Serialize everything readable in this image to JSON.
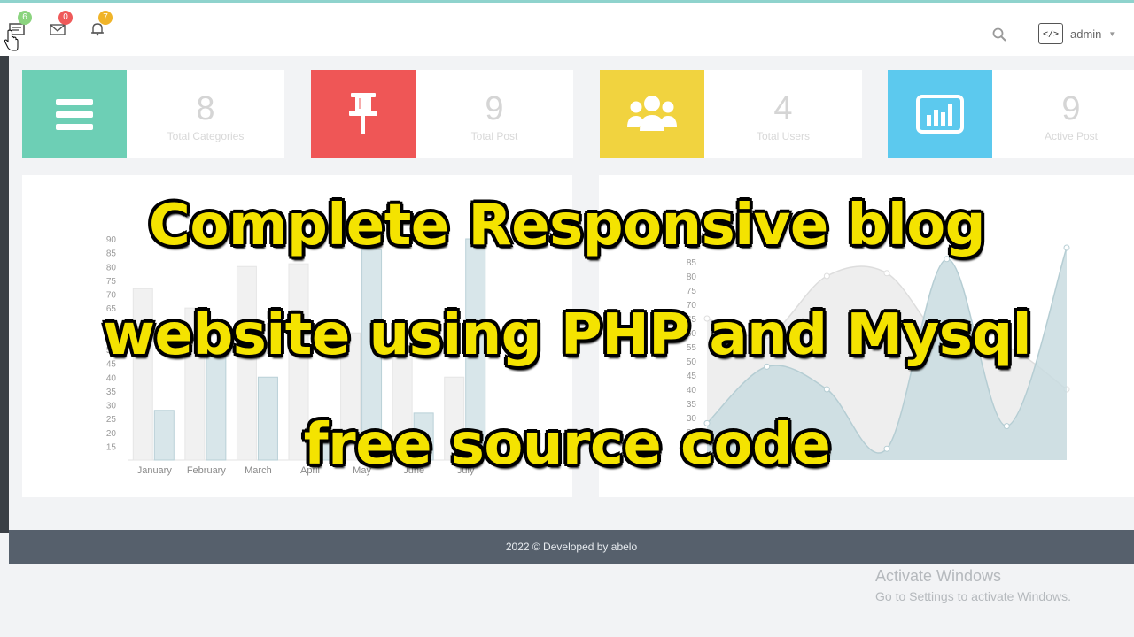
{
  "nav": {
    "messages_badge": "6",
    "mail_badge": "0",
    "notifications_badge": "7"
  },
  "user": {
    "avatar_glyph": "</>",
    "name": "admin",
    "caret": "▼"
  },
  "stats": [
    {
      "value": "8",
      "label": "Total Categories",
      "color": "#6dcfb5",
      "icon": "menu-icon"
    },
    {
      "value": "9",
      "label": "Total Post",
      "color": "#ef5656",
      "icon": "pin-icon"
    },
    {
      "value": "4",
      "label": "Total Users",
      "color": "#f1d33f",
      "icon": "users-icon"
    },
    {
      "value": "9",
      "label": "Active Post",
      "color": "#5cc9ee",
      "icon": "bar-chart-icon"
    }
  ],
  "chart_data": [
    {
      "type": "bar",
      "categories": [
        "January",
        "February",
        "March",
        "April",
        "May",
        "June",
        "July"
      ],
      "series": [
        {
          "values": [
            72,
            65,
            80,
            81,
            56,
            55,
            40
          ]
        },
        {
          "values": [
            28,
            48,
            40,
            19,
            86,
            27,
            90
          ]
        }
      ],
      "yticks": [
        15,
        20,
        25,
        30,
        35,
        40,
        45,
        50,
        55,
        60,
        65,
        70,
        75,
        80,
        85,
        90
      ],
      "ylim": [
        10,
        90
      ]
    },
    {
      "type": "area",
      "x": [
        1,
        2,
        3,
        4,
        5,
        6,
        7
      ],
      "series": [
        {
          "values": [
            65,
            59,
            80,
            81,
            56,
            55,
            40
          ]
        },
        {
          "values": [
            28,
            48,
            40,
            19,
            86,
            27,
            90
          ]
        }
      ],
      "yticks": [
        20,
        25,
        30,
        35,
        40,
        45,
        50,
        55,
        60,
        65,
        70,
        75,
        80,
        85
      ],
      "ylim": [
        15,
        90
      ]
    }
  ],
  "footer": {
    "text": "2022 © Developed by abelo"
  },
  "windows_notice": {
    "line1": "Activate Windows",
    "line2": "Go to Settings to activate Windows."
  },
  "overlay": {
    "line1": "Complete Responsive blog",
    "line2": "website using PHP and Mysql",
    "line3": "free source code"
  }
}
